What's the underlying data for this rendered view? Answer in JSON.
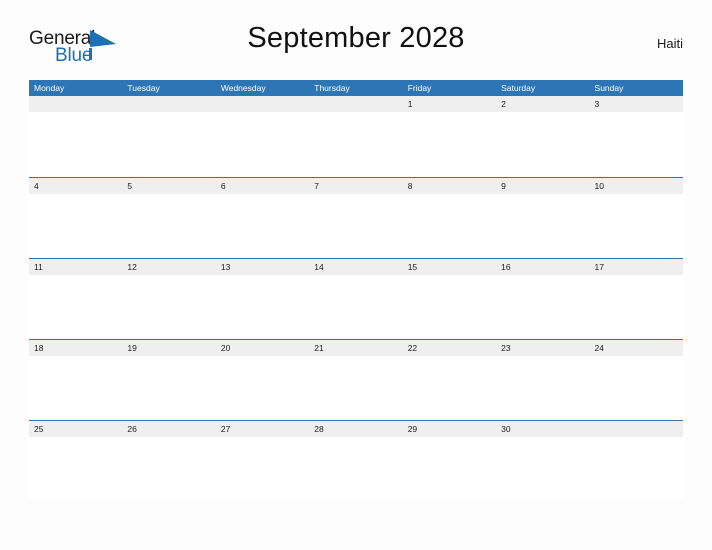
{
  "logo": {
    "word_one": "General",
    "word_two": "Blue",
    "icon": "triangle-flag-icon",
    "brand_color": "#1f6fb5"
  },
  "header": {
    "title": "September 2028",
    "country": "Haiti"
  },
  "theme": {
    "header_blue": "#2e75b6",
    "band_gray": "#efefef",
    "page_background": "#fdfdfd",
    "text_dark": "#222222"
  },
  "calendar": {
    "month": "September",
    "year": "2028",
    "week_start": "Monday",
    "day_headers": [
      "Monday",
      "Tuesday",
      "Wednesday",
      "Thursday",
      "Friday",
      "Saturday",
      "Sunday"
    ],
    "weeks": [
      {
        "days": [
          "",
          "",
          "",
          "",
          "1",
          "2",
          "3"
        ]
      },
      {
        "days": [
          "4",
          "5",
          "6",
          "7",
          "8",
          "9",
          "10"
        ]
      },
      {
        "days": [
          "11",
          "12",
          "13",
          "14",
          "15",
          "16",
          "17"
        ]
      },
      {
        "days": [
          "18",
          "19",
          "20",
          "21",
          "22",
          "23",
          "24"
        ]
      },
      {
        "days": [
          "25",
          "26",
          "27",
          "28",
          "29",
          "30",
          ""
        ]
      }
    ]
  }
}
